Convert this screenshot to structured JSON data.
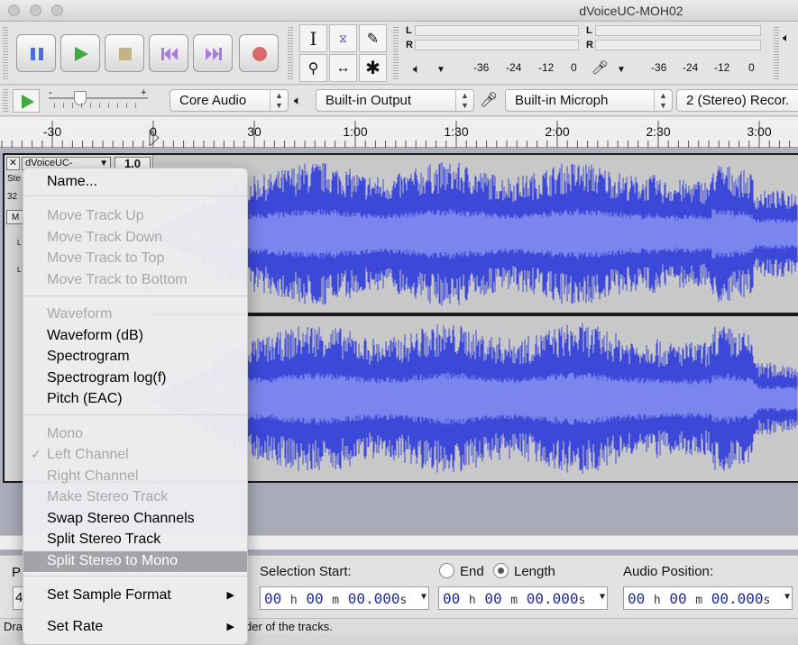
{
  "window": {
    "title": "dVoiceUC-MOH02"
  },
  "meters": {
    "playback_channels": [
      "L",
      "R"
    ],
    "record_channels": [
      "L",
      "R"
    ],
    "playback_scale": [
      "-36",
      "-24",
      "-12",
      "0"
    ],
    "record_scale": [
      "-36",
      "-24",
      "-12",
      "0"
    ]
  },
  "device_toolbar": {
    "host": "Core Audio",
    "output": "Built-in Output",
    "input": "Built-in Microph",
    "channels": "2 (Stereo) Recor."
  },
  "ruler": {
    "ticks": [
      "-30",
      "0",
      "30",
      "1:00",
      "1:30",
      "2:00",
      "2:30",
      "3:00"
    ]
  },
  "track": {
    "name": "dVoiceUC-",
    "gain": "1.0",
    "info_line1": "Ste",
    "info_line2": "32",
    "mute_abbrev": "M",
    "left_marks": [
      "L",
      "L"
    ]
  },
  "menu": {
    "items": [
      {
        "label": "Name...",
        "enabled": true
      },
      {
        "label": "Move Track Up",
        "enabled": false
      },
      {
        "label": "Move Track Down",
        "enabled": false
      },
      {
        "label": "Move Track to Top",
        "enabled": false
      },
      {
        "label": "Move Track to Bottom",
        "enabled": false
      },
      {
        "label": "Waveform",
        "enabled": false
      },
      {
        "label": "Waveform (dB)",
        "enabled": true
      },
      {
        "label": "Spectrogram",
        "enabled": true
      },
      {
        "label": "Spectrogram log(f)",
        "enabled": true
      },
      {
        "label": "Pitch (EAC)",
        "enabled": true
      },
      {
        "label": "Mono",
        "enabled": false
      },
      {
        "label": "Left Channel",
        "enabled": false,
        "checked": true
      },
      {
        "label": "Right Channel",
        "enabled": false
      },
      {
        "label": "Make Stereo Track",
        "enabled": false
      },
      {
        "label": "Swap Stereo Channels",
        "enabled": true
      },
      {
        "label": "Split Stereo Track",
        "enabled": true
      },
      {
        "label": "Split Stereo to Mono",
        "enabled": true,
        "highlighted": true
      },
      {
        "label": "Set Sample Format",
        "enabled": true,
        "submenu": true
      },
      {
        "label": "Set Rate",
        "enabled": true,
        "submenu": true
      }
    ]
  },
  "selection_bar": {
    "left_label_fragment": "P",
    "left_value_fragment": "4",
    "selection_start_label": "Selection Start:",
    "end_label": "End",
    "length_label": "Length",
    "length_selected": true,
    "audio_position_label": "Audio Position:",
    "start_time": {
      "h": "00",
      "m": "00",
      "s": "00.000"
    },
    "length_time": {
      "h": "00",
      "m": "00",
      "s": "00.000"
    },
    "position_time": {
      "h": "00",
      "m": "00",
      "s": "00.000"
    },
    "unit_h": "h",
    "unit_m": "m",
    "unit_s": "s"
  },
  "status": {
    "left_fragment": "Dra",
    "text_fragment": "der of the tracks."
  },
  "colors": {
    "waveform": "#3c48d8",
    "waveform_rms": "#7a86ee",
    "menu_highlight": "#a4a4a8"
  }
}
